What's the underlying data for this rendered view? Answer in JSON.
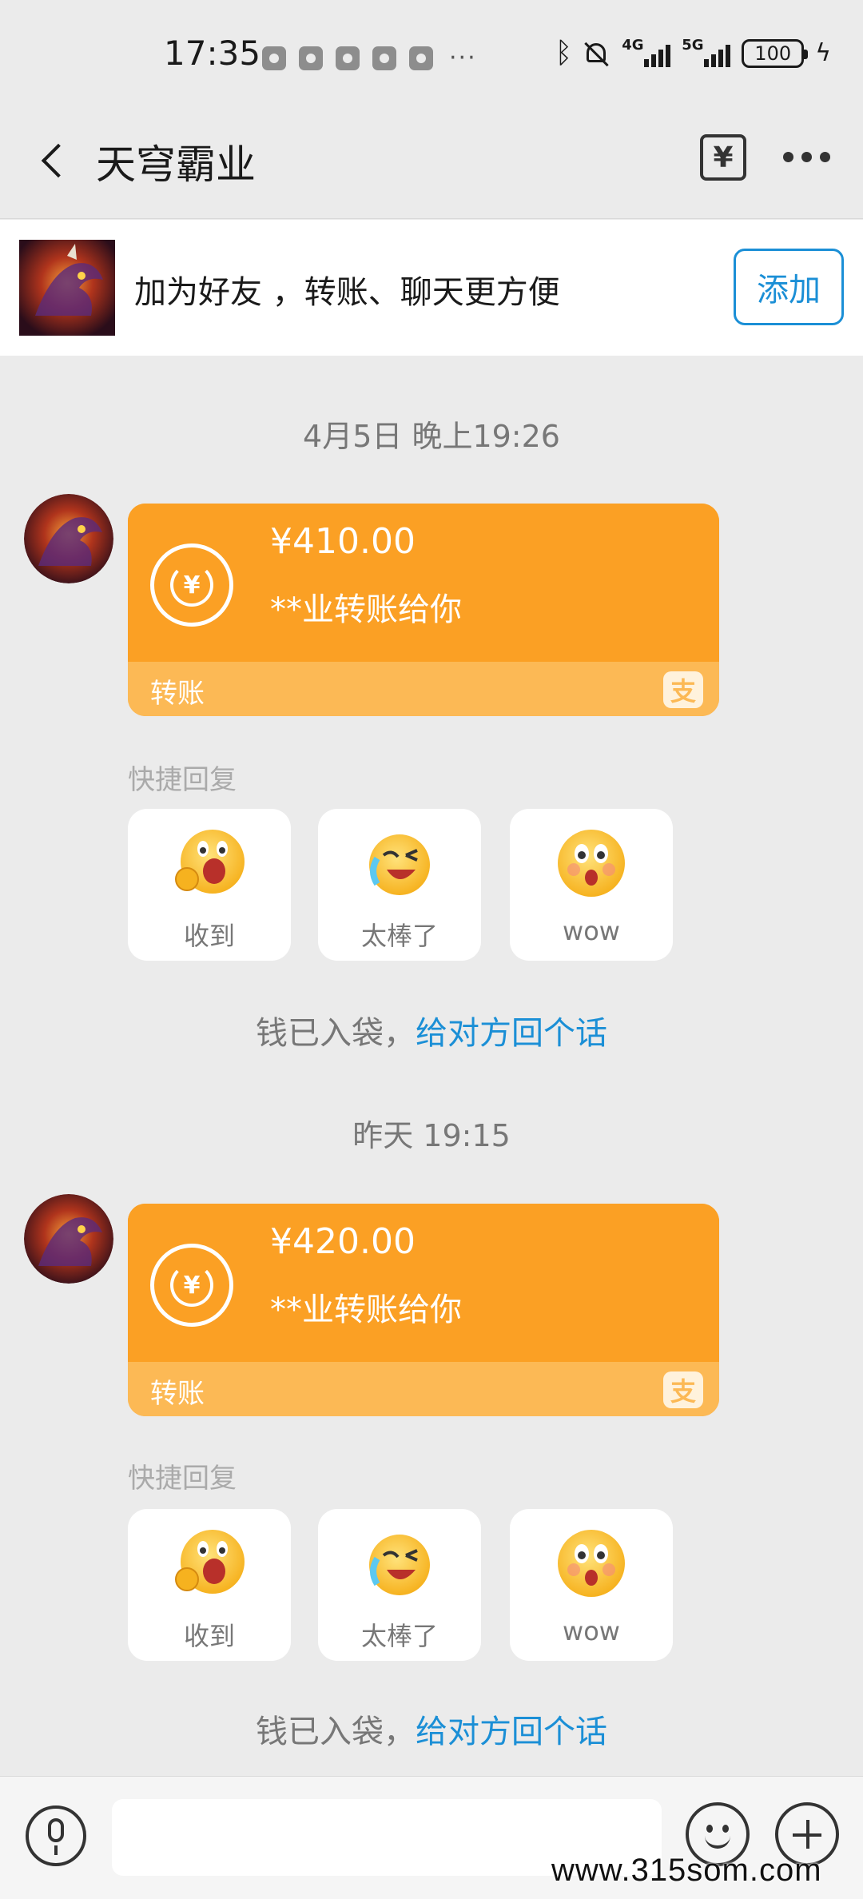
{
  "status_bar": {
    "time": "17:35",
    "more": "···",
    "network_4g": "4G",
    "network_5g": "5G",
    "battery": "100"
  },
  "header": {
    "title": "天穹霸业",
    "transfer_icon_glyph": "¥"
  },
  "friend_banner": {
    "text": "加为好友 ，转账、聊天更方便",
    "add_label": "添加"
  },
  "messages": [
    {
      "timestamp": "4月5日 晚上19:26",
      "amount": "¥410.00",
      "sender": "**业转账给你",
      "card_label": "转账",
      "quick_reply_title": "快捷回复",
      "quick_replies": [
        "收到",
        "太棒了",
        "wow"
      ],
      "system_prefix": "钱已入袋，",
      "system_link": "给对方回个话"
    },
    {
      "timestamp": "昨天 19:15",
      "amount": "¥420.00",
      "sender": "**业转账给你",
      "card_label": "转账",
      "quick_reply_title": "快捷回复",
      "quick_replies": [
        "收到",
        "太棒了",
        "wow"
      ],
      "system_prefix": "钱已入袋，",
      "system_link": "给对方回个话"
    }
  ],
  "alipay_glyph": "支",
  "watermark": "www.315som.com",
  "colors": {
    "accent": "#1b8fd6",
    "card": "#fba024",
    "card_footer": "#fcb955",
    "background": "#ebebeb"
  }
}
